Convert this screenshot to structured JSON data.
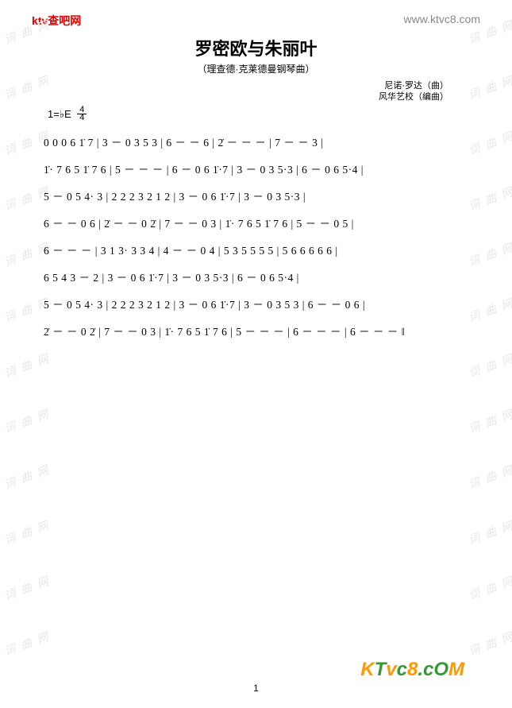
{
  "header": {
    "left": "ktv查吧网",
    "right": "www.ktvc8.com"
  },
  "title": "罗密欧与朱丽叶",
  "subtitle": "（理查德·克莱德曼钢琴曲）",
  "credits": {
    "composer": "尼诺·罗达（曲）",
    "arranger": "风华艺校（编曲）"
  },
  "key": "1=♭E",
  "time": {
    "num": "4",
    "den": "4"
  },
  "score_lines": [
    "0 0 0 6 1̇ 7 | 3 － 0 3 5 3 | 6 － － 6 | 2̇ － － － | 7 － － 3 |",
    "1̇· 7 6 5 1̇ 7 6 | 5 － － － | 6 － 0 6 1̇·7 | 3 － 0 3 5·3 | 6 － 0 6 5·4 |",
    "5 － 0 5 4· 3 | 2 2 2 3 2 1 2 | 3 － 0 6 1̇·7 | 3 － 0 3 5·3 |",
    "6 － － 0 6 | 2̇ － － 0 2̇ | 7 － － 0 3 | 1̇· 7 6 5 1̇ 7 6 | 5 － － 0 5 |",
    "6 － － － | 3 1 3· 3 3 4 | 4 － － 0 4 | 5 3 5 5 5 5 | 5 6 6 6 6 6 |",
    "6 5 4 3 － 2 | 3 － 0 6 1̇·7 | 3 － 0 3 5·3 | 6 － 0 6 5·4 |",
    "5 － 0 5 4· 3 | 2 2 2 3 2 1 2 | 3 － 0 6 1̇·7 | 3 － 0 3 5 3 | 6 － － 0 6 |",
    "2̇ － － 0 2̇ | 7 － － 0 3 | 1̇· 7 6 5 1̇ 7 6 | 5 － － － | 6 － － － | 6 － － － ‖"
  ],
  "watermark": "词 曲 网",
  "page_number": "1",
  "logo": {
    "k": "K",
    "t": "T",
    "v": "v",
    "c": "c",
    "n8": "8",
    "dot": ".",
    "co": "cO",
    "m": "M"
  }
}
